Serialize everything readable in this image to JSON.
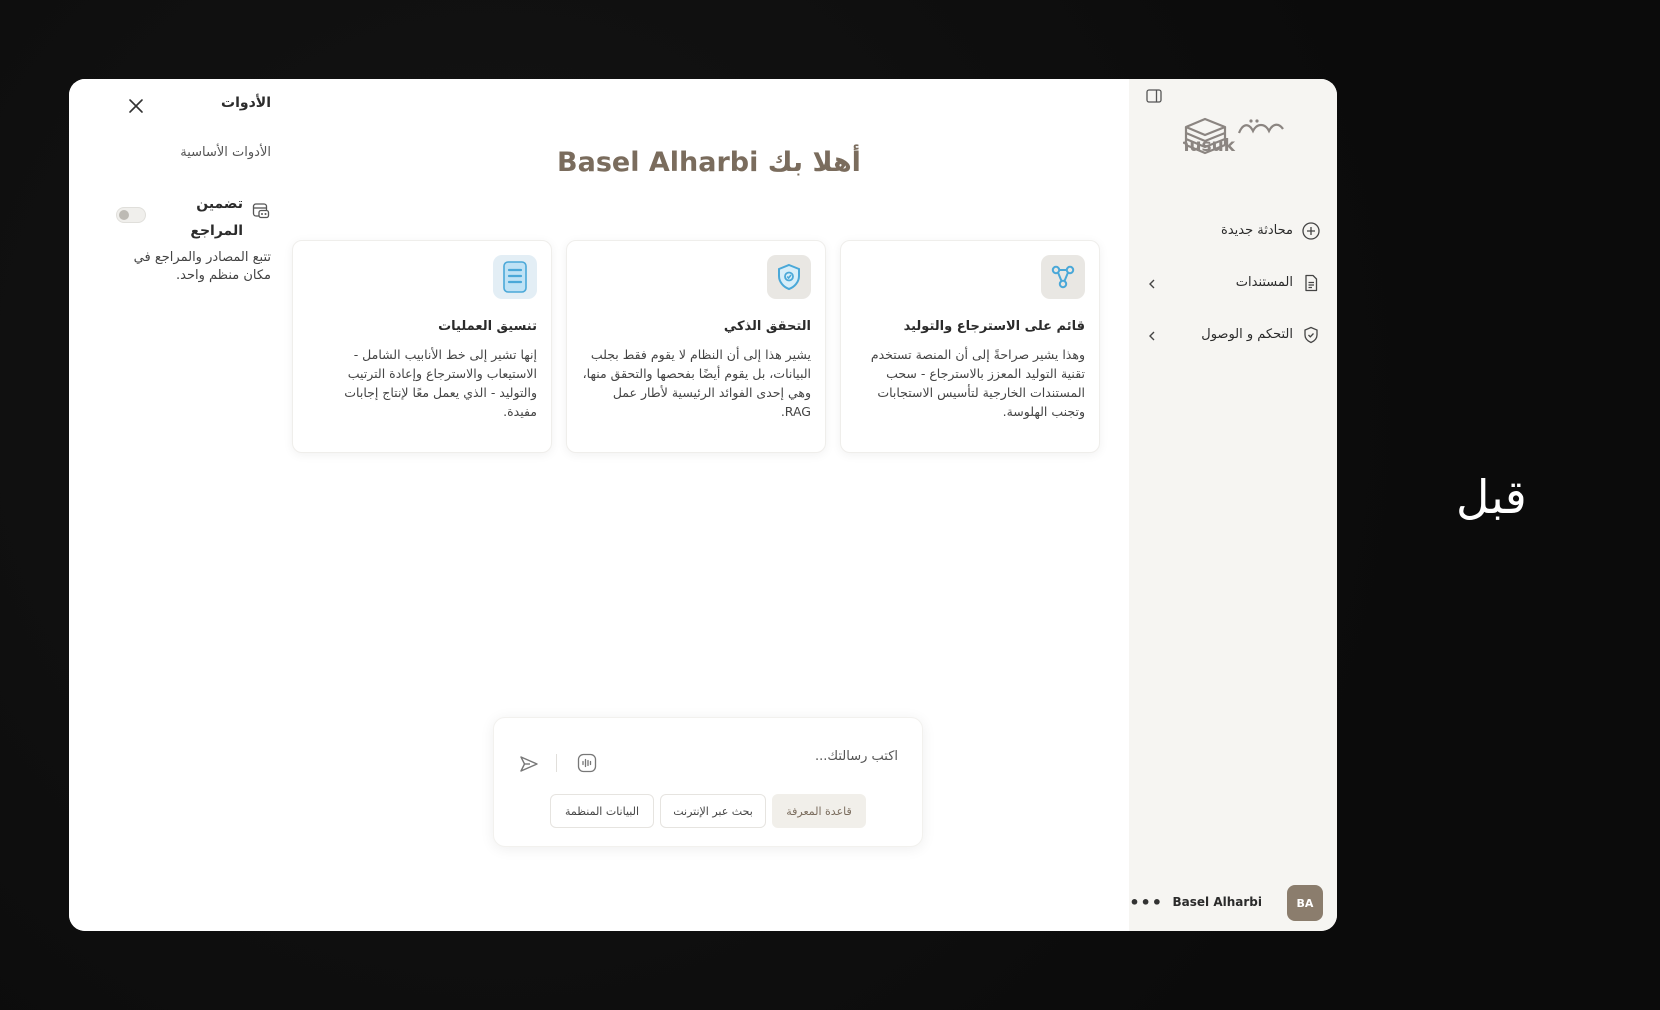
{
  "tools_panel": {
    "title": "الأدوات",
    "section": "الأدوات الأساسية",
    "tool": {
      "name": "تضمين المراجع",
      "description": "تتبع المصادر والمراجع في مكان منظم واحد.",
      "enabled": false
    }
  },
  "main": {
    "welcome": "أهلا بك Basel Alharbi",
    "cards": [
      {
        "title": "قائم على الاسترجاع والتوليد",
        "description": "وهذا يشير صراحةً إلى أن المنصة تستخدم تقنية التوليد المعزز بالاسترجاع - سحب المستندات الخارجية لتأسيس الاستجابات وتجنب الهلوسة.",
        "icon": "graph-nodes-icon"
      },
      {
        "title": "التحقق الذكي",
        "description": "يشير هذا إلى أن النظام لا يقوم فقط بجلب البيانات، بل يقوم أيضًا بفحصها والتحقق منها، وهي إحدى الفوائد الرئيسية لأطار عمل RAG.",
        "icon": "shield-check-icon"
      },
      {
        "title": "تنسيق العمليات",
        "description": "إنها تشير إلى خط الأنابيب الشامل - الاستيعاب والاسترجاع وإعادة الترتيب والتوليد - الذي يعمل معًا لإنتاج إجابات مفيدة.",
        "icon": "document-lines-icon"
      }
    ],
    "composer": {
      "placeholder": "اكتب رسالتك...",
      "chips": [
        "قاعدة المعرفة",
        "بحث عبر الإنترنت",
        "البيانات المنظمة"
      ],
      "active_chip": "قاعدة المعرفة"
    }
  },
  "sidebar": {
    "logo_text": "nusuk",
    "nav": [
      {
        "label": "محادثة جديدة",
        "icon": "plus-circle-icon",
        "has_chevron": false
      },
      {
        "label": "المستندات",
        "icon": "document-icon",
        "has_chevron": true
      },
      {
        "label": "التحكم و الوصول",
        "icon": "shield-icon",
        "has_chevron": true
      }
    ],
    "user": {
      "initials": "BA",
      "name": "Basel Alharbi",
      "more": "•••"
    }
  },
  "side_label": "قبل",
  "colors": {
    "accent": "#7a6c5d",
    "sidebar_bg": "#f6f5f2",
    "icon_blue": "#4aa8d8",
    "background": "#0d0d0d"
  }
}
